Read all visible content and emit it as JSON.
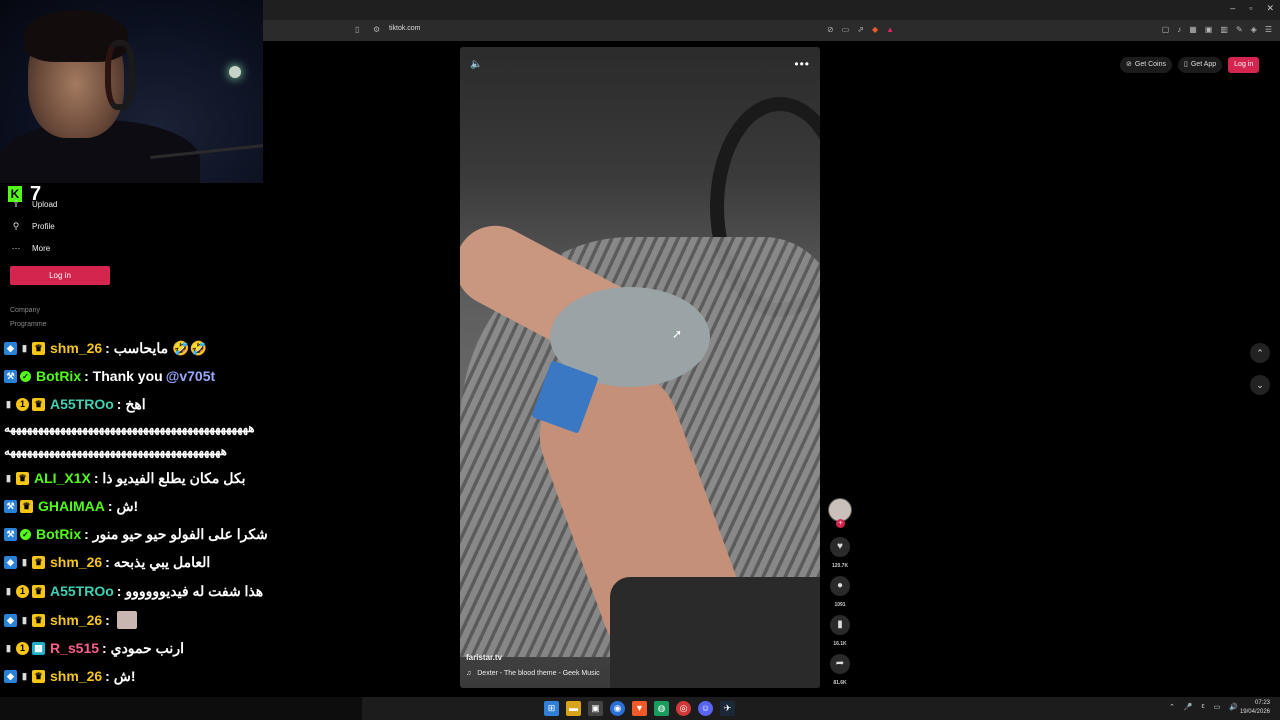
{
  "browser": {
    "url": "tiktok.com",
    "window_controls": [
      "–",
      "▫",
      "✕"
    ],
    "toolbar_icons": [
      "▢",
      "♪",
      "▦",
      "▣",
      "▥",
      "✎",
      "◈",
      "☰"
    ]
  },
  "stream": {
    "kick_logo": "K",
    "viewer_count": "7"
  },
  "sidebar": {
    "items": [
      {
        "label": "Upload",
        "icon": "upload-icon",
        "glyph": "⇪"
      },
      {
        "label": "Profile",
        "icon": "profile-icon",
        "glyph": "⚲"
      },
      {
        "label": "More",
        "icon": "more-icon",
        "glyph": "⋯"
      }
    ],
    "login_label": "Log in",
    "footer": [
      "Company",
      "Programme"
    ]
  },
  "chat": {
    "messages": [
      {
        "user": "shm_26",
        "user_color": "#f5c518",
        "badges": [
          "cube",
          "cup",
          "crown"
        ],
        "text": ": مايحاسب 🤣🤣"
      },
      {
        "user": "BotRix",
        "user_color": "#53fc18",
        "badges": [
          "bot",
          "verified"
        ],
        "text": ": Thank you ",
        "mention": "@v705t"
      },
      {
        "user": "A55TROo",
        "user_color": "#3fd1b4",
        "badges": [
          "cup",
          "one",
          "crown"
        ],
        "text": ": اهخ"
      },
      {
        "user": "ALI_X1X",
        "user_color": "#53fc18",
        "badges": [
          "cup",
          "crown"
        ],
        "text": ": بكل مكان يطلع الفيديو ذا"
      },
      {
        "user": "GHAIMAA",
        "user_color": "#53fc18",
        "badges": [
          "bot",
          "crown"
        ],
        "text": ": ش!"
      },
      {
        "user": "BotRix",
        "user_color": "#53fc18",
        "badges": [
          "bot",
          "verified"
        ],
        "text": ": شكرا على الفولو حيو حيو منور"
      },
      {
        "user": "shm_26",
        "user_color": "#f5c518",
        "badges": [
          "cube",
          "cup",
          "crown"
        ],
        "text": ": العامل يبي يذبحه"
      },
      {
        "user": "A55TROo",
        "user_color": "#3fd1b4",
        "badges": [
          "cup",
          "one",
          "crown"
        ],
        "text": ": هذا شفت له فيديوووووو"
      },
      {
        "user": "shm_26",
        "user_color": "#f5c518",
        "badges": [
          "cube",
          "cup",
          "crown"
        ],
        "text": ":"
      },
      {
        "user": "R_s515",
        "user_color": "#ff5e8a",
        "badges": [
          "cup",
          "one",
          "grid"
        ],
        "text": ": ارنب حمودي"
      },
      {
        "user": "shm_26",
        "user_color": "#f5c518",
        "badges": [
          "cube",
          "cup",
          "crown"
        ],
        "text": ": ش!"
      },
      {
        "user": "BotRix",
        "user_color": "#53fc18",
        "badges": [
          "bot",
          "verified"
        ],
        "text": ": شكرا على الفولو حيو حيو منور"
      }
    ],
    "spam_line_1": "ههههههههههههههههههههههههههههههههههههههههههههه",
    "spam_line_2": "هههههههههههههههههههههههههههههههههههههههه"
  },
  "video": {
    "watermark": "faristar.tv",
    "music": "Dexter - The blood theme - Geek Music"
  },
  "rail": {
    "like_count": "120.7K",
    "comment_count": "1091",
    "save_count": "16.1K",
    "share_count": "81.6K"
  },
  "top_right": {
    "coins_label": "Get Coins",
    "app_label": "Get App",
    "login_label": "Log in"
  },
  "taskbar": {
    "time": "07:23",
    "date": "19/04/2026"
  }
}
